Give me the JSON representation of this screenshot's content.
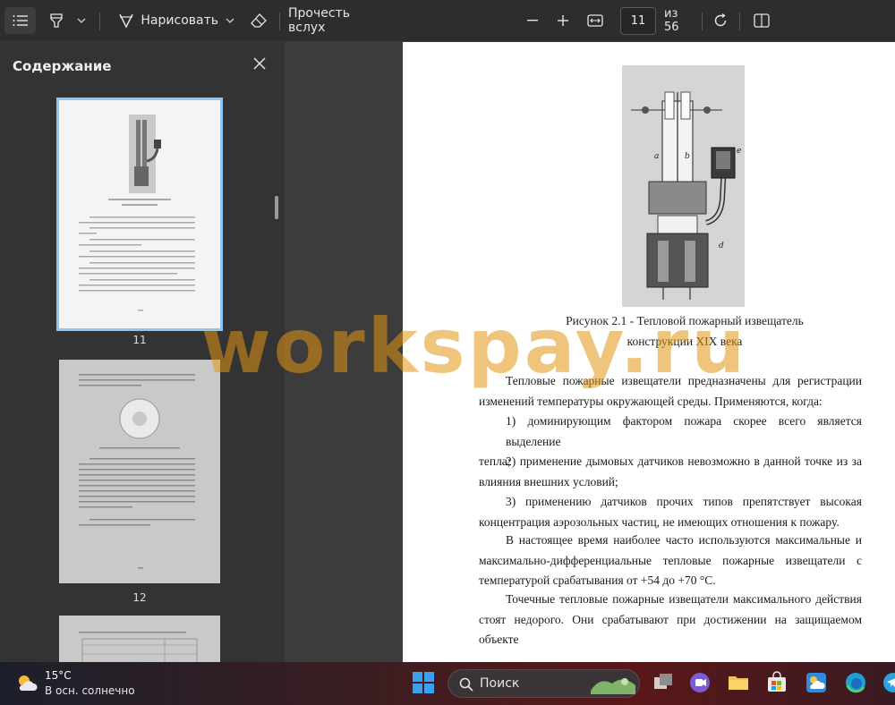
{
  "toolbar": {
    "draw_label": "Нарисовать",
    "read_aloud_label": "Прочесть вслух",
    "page_current": "11",
    "page_total_label": "из 56"
  },
  "sidebar": {
    "title": "Содержание",
    "thumbnails": [
      {
        "page": "11",
        "selected": true
      },
      {
        "page": "12",
        "selected": false
      }
    ]
  },
  "document": {
    "figure_caption_line1": "Рисунок 2.1 - Тепловой пожарный извещатель",
    "figure_caption_line2": "конструкции XIX века",
    "paragraphs": [
      {
        "lines": [
          "Тепловые пожарные извещатели предназначены для регистрации",
          "изменений температуры окружающей среды. Применяются, когда:"
        ]
      },
      {
        "lines": [
          "1) доминирующим фактором пожара скорее всего является выделение",
          "тепла;"
        ]
      },
      {
        "lines": [
          "2) применение дымовых датчиков невозможно в данной точке из за",
          "влияния внешних условий;"
        ]
      },
      {
        "lines": [
          "3) применению датчиков прочих типов препятствует высокая",
          "концентрация аэрозольных частиц, не имеющих отношения к пожару."
        ]
      },
      {
        "lines": [
          "В настоящее время наиболее часто используются максимальные и",
          "максимально-дифференциальные тепловые пожарные извещатели с",
          "температурой срабатывания  от +54 до +70 °С."
        ]
      },
      {
        "lines": [
          "Точечные тепловые пожарные извещатели максимального действия",
          "стоят недорого. Они срабатывают при достижении на защищаемом объекте"
        ]
      }
    ]
  },
  "watermark": "workspay.ru",
  "taskbar": {
    "temperature": "15°C",
    "weather": "В осн. солнечно",
    "search_label": "Поиск"
  }
}
